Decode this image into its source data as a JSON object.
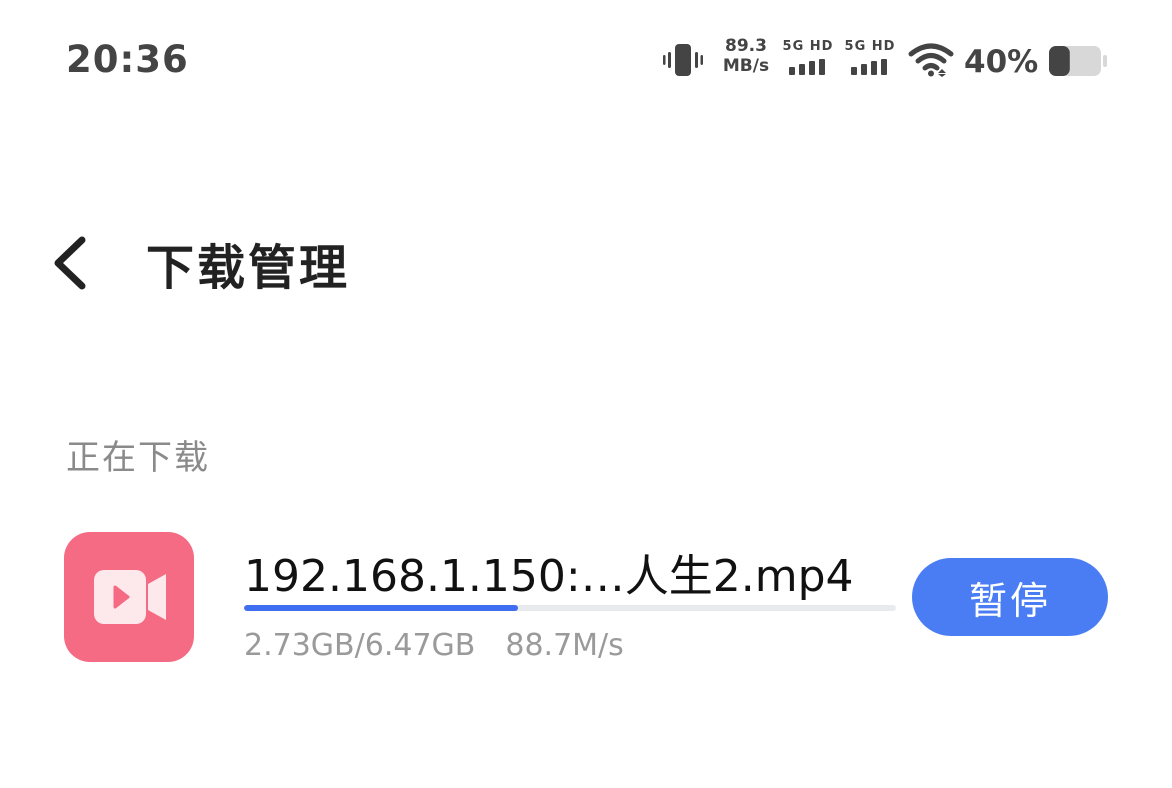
{
  "status_bar": {
    "time": "20:36",
    "net_speed_value": "89.3",
    "net_speed_unit": "MB/s",
    "signal_1_label": "5G HD",
    "signal_2_label": "5G HD",
    "battery_percent": "40%",
    "battery_level": 0.4
  },
  "header": {
    "title": "下载管理"
  },
  "section": {
    "label": "正在下载"
  },
  "download": {
    "file_name": "192.168.1.150:…人生2.mp4",
    "size_progress": "2.73GB/6.47GB",
    "speed": "88.7M/s",
    "progress_fraction": 0.42,
    "pause_label": "暂停",
    "accent_color": "#4a7df4",
    "icon_color": "#f46b83"
  }
}
